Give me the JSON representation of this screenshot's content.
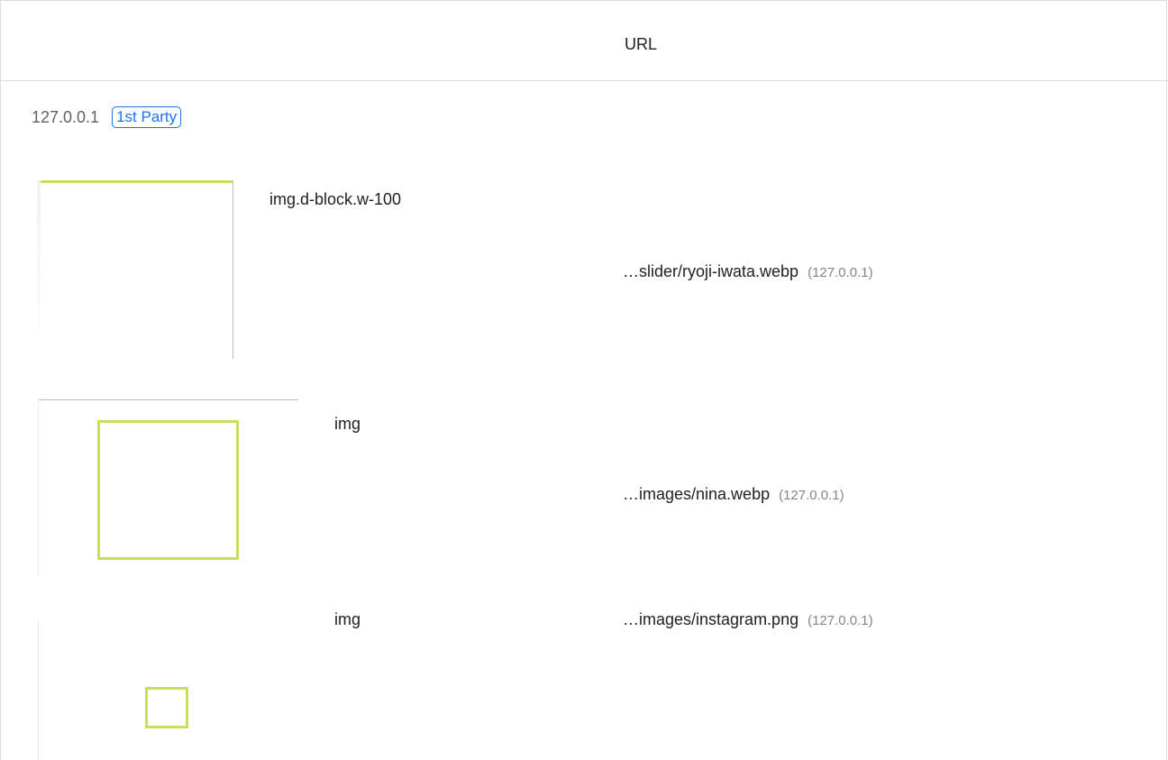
{
  "header": {
    "column_url": "URL"
  },
  "group": {
    "host": "127.0.0.1",
    "badge": "1st Party"
  },
  "rows": [
    {
      "node": "img.d-block.w-100",
      "url_path": "…slider/ryoji-iwata.webp",
      "url_host": "(127.0.0.1)"
    },
    {
      "node": "img",
      "url_path": "…images/nina.webp",
      "url_host": "(127.0.0.1)"
    },
    {
      "node": "img",
      "url_path": "…images/instagram.png",
      "url_host": "(127.0.0.1)"
    }
  ],
  "colors": {
    "highlight": "#cddc59",
    "link_blue": "#1a73e8",
    "muted": "#80868b"
  }
}
